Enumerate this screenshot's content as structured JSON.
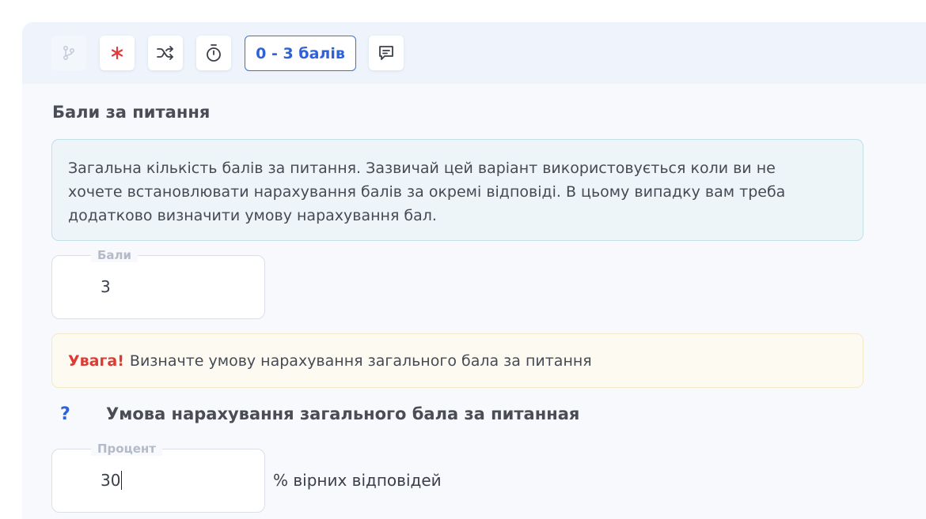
{
  "toolbar": {
    "buttons": [
      {
        "name": "branch-icon",
        "state": "disabled"
      },
      {
        "name": "required-asterisk-icon",
        "color": "#e03c3c"
      },
      {
        "name": "shuffle-icon"
      },
      {
        "name": "timer-icon"
      },
      {
        "name": "comment-icon"
      }
    ],
    "range_label": "0 - 3 балів"
  },
  "section": {
    "title": "Бали за питання"
  },
  "info": {
    "lines": [
      "Загальна кількість балів за питання. Зазвичай цей варіант використовується коли ви не",
      "хочете встановлювати нарахування балів за окремі відповіді. В цьому випадку вам треба",
      "додатково визначити умову нарахування бал."
    ]
  },
  "points_field": {
    "label": "Бали",
    "value": "3"
  },
  "warning": {
    "strong": "Увага!",
    "text": "Визначте умову нарахування загального бала за питання"
  },
  "condition": {
    "help_icon": "?",
    "title": "Умова нарахування загального бала за питанная"
  },
  "percent_field": {
    "label": "Процент",
    "value": "30",
    "suffix": "% вірних відповідей"
  },
  "colors": {
    "accent": "#2f62d6",
    "danger": "#dc3b34",
    "panel_bg": "#f8f9fd",
    "toolbar_bg": "#eef3fc",
    "info_bg": "#eef5f9",
    "warning_bg": "#fdfbf1"
  }
}
